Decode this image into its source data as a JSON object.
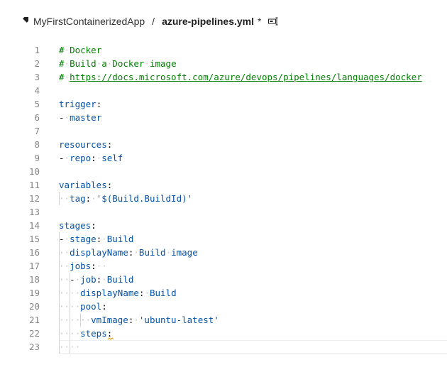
{
  "breadcrumb": {
    "repo_icon": "git-repo-icon",
    "repo": "MyFirstContainerizedApp",
    "separator": "/",
    "file": "azure-pipelines.yml",
    "dirty_marker": "*",
    "rename_icon": "rename-icon"
  },
  "editor": {
    "lines": [
      {
        "num": "1",
        "text": "# Docker"
      },
      {
        "num": "2",
        "text": "# Build a Docker image"
      },
      {
        "num": "3",
        "text": "# https://docs.microsoft.com/azure/devops/pipelines/languages/docker"
      },
      {
        "num": "4",
        "text": ""
      },
      {
        "num": "5",
        "text": "trigger:"
      },
      {
        "num": "6",
        "text": "- master"
      },
      {
        "num": "7",
        "text": ""
      },
      {
        "num": "8",
        "text": "resources:"
      },
      {
        "num": "9",
        "text": "- repo: self"
      },
      {
        "num": "10",
        "text": ""
      },
      {
        "num": "11",
        "text": "variables:"
      },
      {
        "num": "12",
        "text": "  tag: '$(Build.BuildId)'"
      },
      {
        "num": "13",
        "text": ""
      },
      {
        "num": "14",
        "text": "stages:"
      },
      {
        "num": "15",
        "text": "- stage: Build"
      },
      {
        "num": "16",
        "text": "  displayName: Build image"
      },
      {
        "num": "17",
        "text": "  jobs:  "
      },
      {
        "num": "18",
        "text": "  - job: Build"
      },
      {
        "num": "19",
        "text": "    displayName: Build"
      },
      {
        "num": "20",
        "text": "    pool:"
      },
      {
        "num": "21",
        "text": "      vmImage: 'ubuntu-latest'"
      },
      {
        "num": "22",
        "text": "    steps:"
      },
      {
        "num": "23",
        "text": "    "
      }
    ],
    "current_line": 23
  },
  "colors": {
    "comment": "#008000",
    "key": "#0451a5",
    "line_number": "#858585",
    "whitespace": "#c8c8c8",
    "warning": "#e5a000"
  }
}
